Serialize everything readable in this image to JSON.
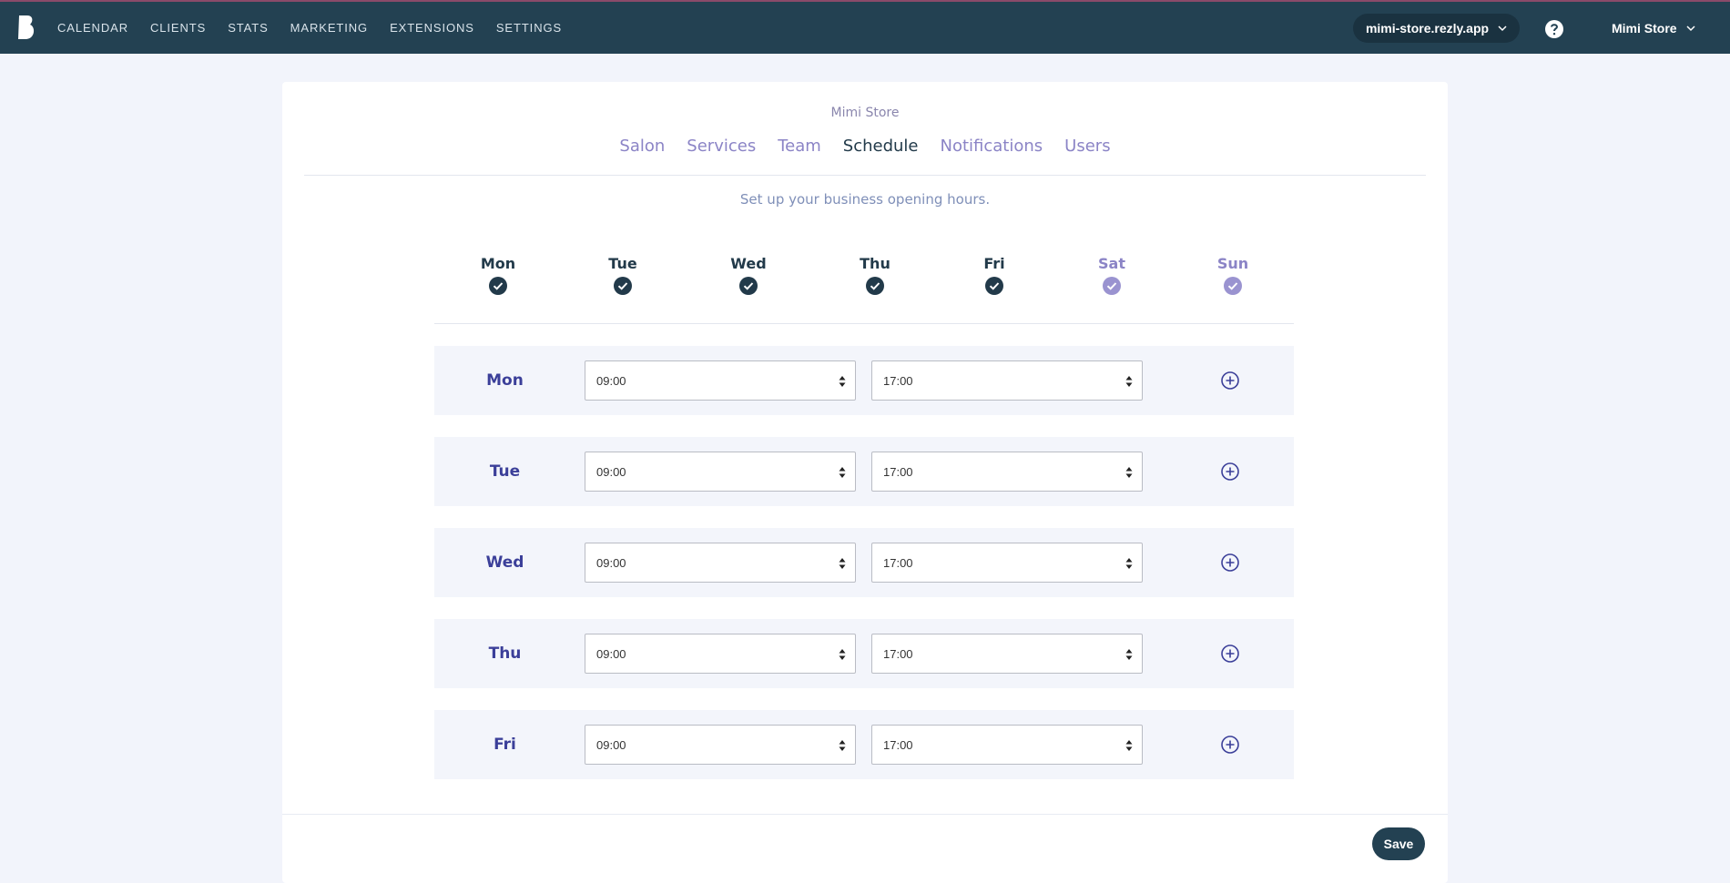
{
  "app": {
    "logo_icon": "brand-b-icon",
    "nav": [
      "CALENDAR",
      "CLIENTS",
      "STATS",
      "MARKETING",
      "EXTENSIONS",
      "SETTINGS"
    ],
    "domain": "mimi-store.rezly.app",
    "user": "Mimi Store"
  },
  "settings": {
    "store_name": "Mimi Store",
    "tabs": [
      "Salon",
      "Services",
      "Team",
      "Schedule",
      "Notifications",
      "Users"
    ],
    "active_tab": "Schedule",
    "subtitle": "Set up your business opening hours."
  },
  "days": [
    {
      "label": "Mon",
      "enabled": true
    },
    {
      "label": "Tue",
      "enabled": true
    },
    {
      "label": "Wed",
      "enabled": true
    },
    {
      "label": "Thu",
      "enabled": true
    },
    {
      "label": "Fri",
      "enabled": true
    },
    {
      "label": "Sat",
      "enabled": false
    },
    {
      "label": "Sun",
      "enabled": false
    }
  ],
  "hours": [
    {
      "day": "Mon",
      "start": "09:00",
      "end": "17:00"
    },
    {
      "day": "Tue",
      "start": "09:00",
      "end": "17:00"
    },
    {
      "day": "Wed",
      "start": "09:00",
      "end": "17:00"
    },
    {
      "day": "Thu",
      "start": "09:00",
      "end": "17:00"
    },
    {
      "day": "Fri",
      "start": "09:00",
      "end": "17:00"
    }
  ],
  "actions": {
    "save": "Save"
  },
  "colors": {
    "nav_bg": "#234152",
    "accent": "#3b3f99",
    "muted_purple": "#8b84c6"
  }
}
